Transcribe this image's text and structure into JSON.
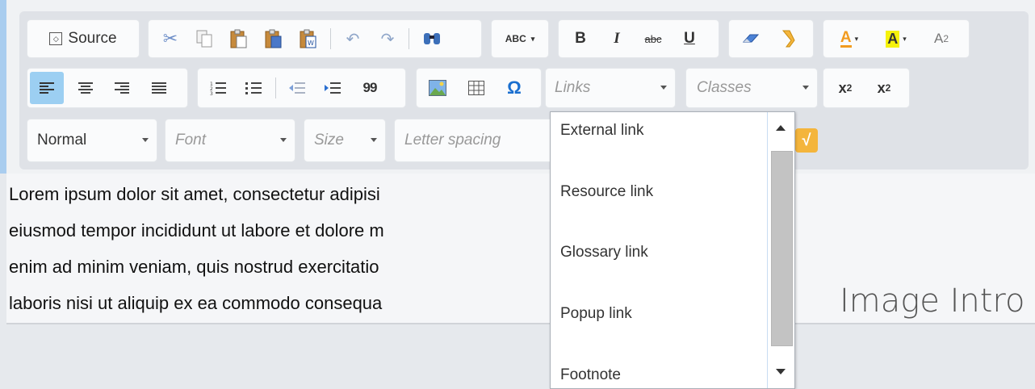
{
  "toolbar": {
    "source_label": "Source",
    "spellcheck_label": "ABC",
    "bold_label": "B",
    "italic_label": "I",
    "strike_label": "abc",
    "underline_label": "U",
    "text_color_label": "A",
    "bg_color_label": "A",
    "ruby_label": "A",
    "ruby_sup": "2",
    "quote_label": "99",
    "subscript_label": "x",
    "subscript_sub": "2",
    "superscript_label": "x",
    "superscript_sup": "2",
    "omega_label": "Ω",
    "sqrt_label": "√",
    "links_placeholder": "Links",
    "classes_placeholder": "Classes",
    "format_value": "Normal",
    "font_placeholder": "Font",
    "size_placeholder": "Size",
    "letter_spacing_placeholder": "Letter spacing"
  },
  "links_dropdown": {
    "items": [
      "External link",
      "Resource link",
      "Glossary link",
      "Popup link",
      "Footnote"
    ]
  },
  "editor": {
    "lines": [
      "Lorem ipsum dolor sit amet, consectetur adipisi",
      "eiusmod tempor incididunt ut labore et dolore m",
      "enim ad minim veniam, quis nostrud exercitatio",
      "laboris nisi ut aliquip ex ea commodo consequa"
    ],
    "image_intro": "Image Intro"
  },
  "colors": {
    "active_button": "#9ccff2",
    "text_color_swatch": "#f29b1f",
    "bg_color_swatch": "#f5f20a",
    "omega": "#1a6fcf",
    "sqrt_badge": "#f4b53c"
  }
}
